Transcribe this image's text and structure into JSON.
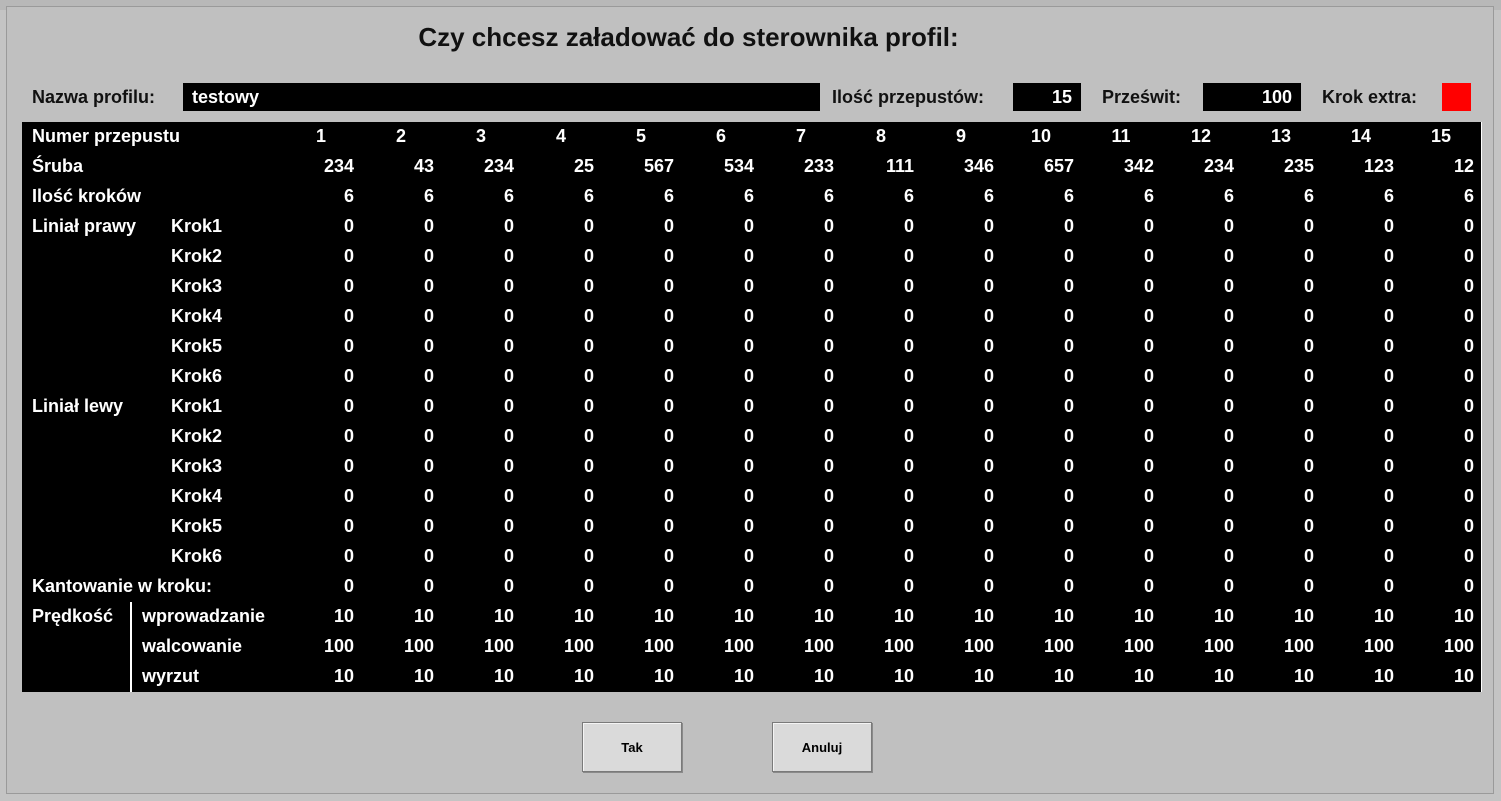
{
  "dialog": {
    "title": "Czy chcesz załadować do sterownika profil:"
  },
  "profile": {
    "name_label": "Nazwa profilu:",
    "name_value": "testowy",
    "passes_label": "Ilość przepustów:",
    "passes_value": "15",
    "clearance_label": "Prześwit:",
    "clearance_value": "100",
    "extra_step_label": "Krok extra:",
    "extra_step_indicator_color": "#ff0000"
  },
  "table": {
    "header": {
      "label": "Numer przepustu",
      "columns": [
        "1",
        "2",
        "3",
        "4",
        "5",
        "6",
        "7",
        "8",
        "9",
        "10",
        "11",
        "12",
        "13",
        "14",
        "15"
      ]
    },
    "screw": {
      "label": "Śruba",
      "values": [
        "234",
        "43",
        "234",
        "25",
        "567",
        "534",
        "233",
        "111",
        "346",
        "657",
        "342",
        "234",
        "235",
        "123",
        "12"
      ]
    },
    "steps_count": {
      "label": "Ilość kroków",
      "values": [
        "6",
        "6",
        "6",
        "6",
        "6",
        "6",
        "6",
        "6",
        "6",
        "6",
        "6",
        "6",
        "6",
        "6",
        "6"
      ]
    },
    "right_ruler": {
      "label": "Liniał prawy",
      "rows": [
        {
          "label": "Krok1",
          "values": [
            "0",
            "0",
            "0",
            "0",
            "0",
            "0",
            "0",
            "0",
            "0",
            "0",
            "0",
            "0",
            "0",
            "0",
            "0"
          ]
        },
        {
          "label": "Krok2",
          "values": [
            "0",
            "0",
            "0",
            "0",
            "0",
            "0",
            "0",
            "0",
            "0",
            "0",
            "0",
            "0",
            "0",
            "0",
            "0"
          ]
        },
        {
          "label": "Krok3",
          "values": [
            "0",
            "0",
            "0",
            "0",
            "0",
            "0",
            "0",
            "0",
            "0",
            "0",
            "0",
            "0",
            "0",
            "0",
            "0"
          ]
        },
        {
          "label": "Krok4",
          "values": [
            "0",
            "0",
            "0",
            "0",
            "0",
            "0",
            "0",
            "0",
            "0",
            "0",
            "0",
            "0",
            "0",
            "0",
            "0"
          ]
        },
        {
          "label": "Krok5",
          "values": [
            "0",
            "0",
            "0",
            "0",
            "0",
            "0",
            "0",
            "0",
            "0",
            "0",
            "0",
            "0",
            "0",
            "0",
            "0"
          ]
        },
        {
          "label": "Krok6",
          "values": [
            "0",
            "0",
            "0",
            "0",
            "0",
            "0",
            "0",
            "0",
            "0",
            "0",
            "0",
            "0",
            "0",
            "0",
            "0"
          ]
        }
      ]
    },
    "left_ruler": {
      "label": "Liniał lewy",
      "rows": [
        {
          "label": "Krok1",
          "values": [
            "0",
            "0",
            "0",
            "0",
            "0",
            "0",
            "0",
            "0",
            "0",
            "0",
            "0",
            "0",
            "0",
            "0",
            "0"
          ]
        },
        {
          "label": "Krok2",
          "values": [
            "0",
            "0",
            "0",
            "0",
            "0",
            "0",
            "0",
            "0",
            "0",
            "0",
            "0",
            "0",
            "0",
            "0",
            "0"
          ]
        },
        {
          "label": "Krok3",
          "values": [
            "0",
            "0",
            "0",
            "0",
            "0",
            "0",
            "0",
            "0",
            "0",
            "0",
            "0",
            "0",
            "0",
            "0",
            "0"
          ]
        },
        {
          "label": "Krok4",
          "values": [
            "0",
            "0",
            "0",
            "0",
            "0",
            "0",
            "0",
            "0",
            "0",
            "0",
            "0",
            "0",
            "0",
            "0",
            "0"
          ]
        },
        {
          "label": "Krok5",
          "values": [
            "0",
            "0",
            "0",
            "0",
            "0",
            "0",
            "0",
            "0",
            "0",
            "0",
            "0",
            "0",
            "0",
            "0",
            "0"
          ]
        },
        {
          "label": "Krok6",
          "values": [
            "0",
            "0",
            "0",
            "0",
            "0",
            "0",
            "0",
            "0",
            "0",
            "0",
            "0",
            "0",
            "0",
            "0",
            "0"
          ]
        }
      ]
    },
    "tilt": {
      "label": "Kantowanie w kroku:",
      "values": [
        "0",
        "0",
        "0",
        "0",
        "0",
        "0",
        "0",
        "0",
        "0",
        "0",
        "0",
        "0",
        "0",
        "0",
        "0"
      ]
    },
    "speed": {
      "label": "Prędkość",
      "rows": [
        {
          "label": "wprowadzanie",
          "values": [
            "10",
            "10",
            "10",
            "10",
            "10",
            "10",
            "10",
            "10",
            "10",
            "10",
            "10",
            "10",
            "10",
            "10",
            "10"
          ]
        },
        {
          "label": "walcowanie",
          "values": [
            "100",
            "100",
            "100",
            "100",
            "100",
            "100",
            "100",
            "100",
            "100",
            "100",
            "100",
            "100",
            "100",
            "100",
            "100"
          ]
        },
        {
          "label": "wyrzut",
          "values": [
            "10",
            "10",
            "10",
            "10",
            "10",
            "10",
            "10",
            "10",
            "10",
            "10",
            "10",
            "10",
            "10",
            "10",
            "10"
          ]
        }
      ]
    }
  },
  "buttons": {
    "yes": "Tak",
    "cancel": "Anuluj"
  }
}
